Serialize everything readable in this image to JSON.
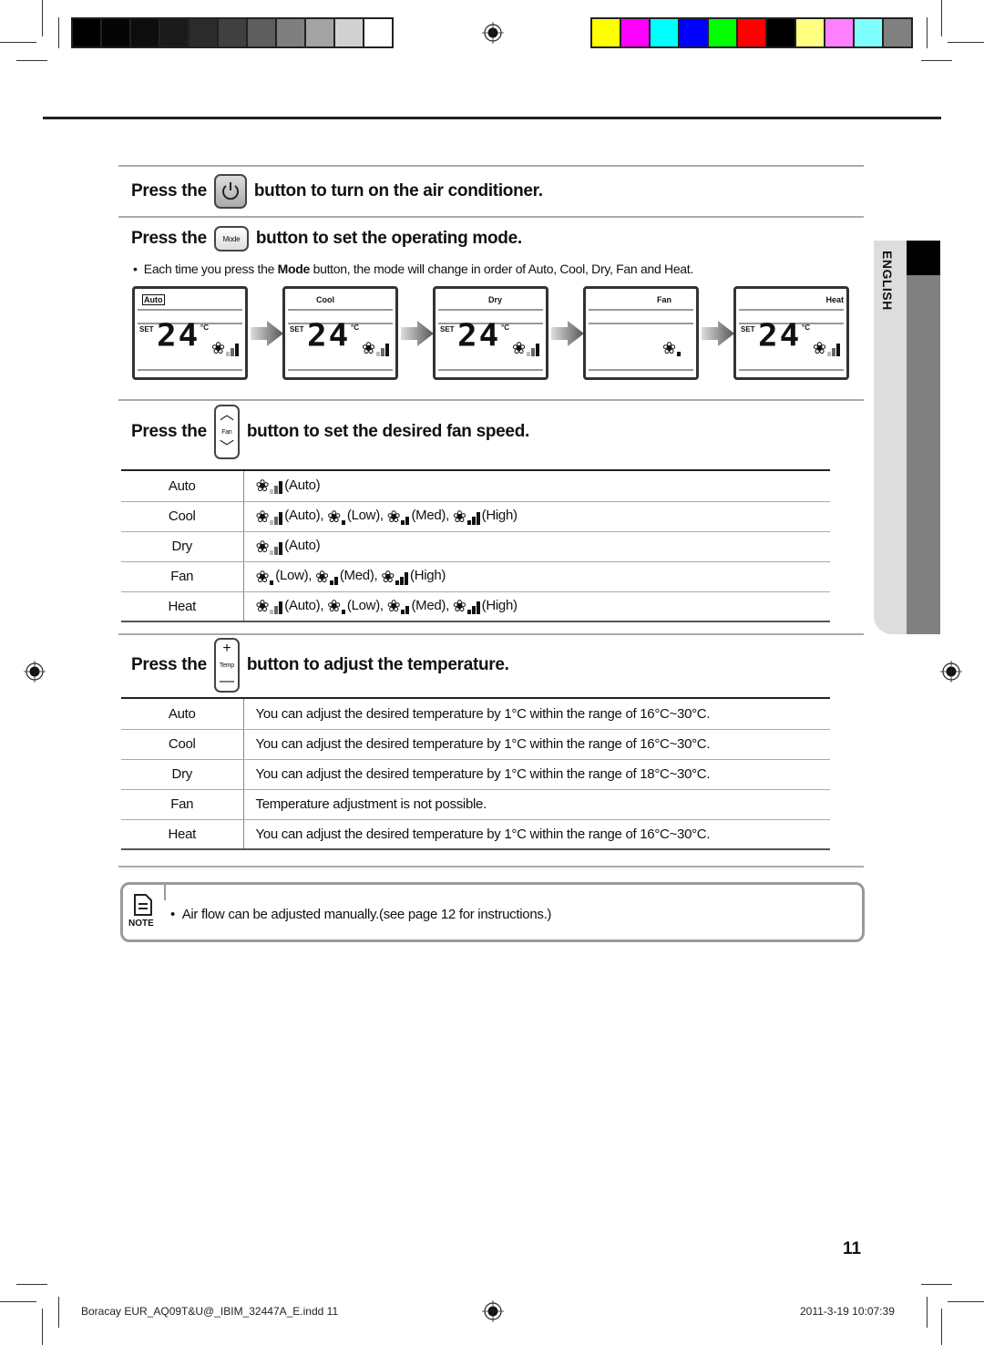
{
  "print_marks": {
    "grayscale_swatches": [
      "#000000",
      "#050505",
      "#0d0d0d",
      "#1a1a1a",
      "#2b2b2b",
      "#404040",
      "#5e5e5e",
      "#7f7f7f",
      "#a3a3a3",
      "#d1d1d1",
      "#ffffff"
    ],
    "color_swatches": [
      "#ffff00",
      "#ff00ff",
      "#00ffff",
      "#0000ff",
      "#00ff00",
      "#ff0000",
      "#000000",
      "#ffff80",
      "#ff80ff",
      "#80ffff",
      "#808080"
    ]
  },
  "side_tab": {
    "label": "ENGLISH"
  },
  "sections": {
    "power": {
      "prefix": "Press the",
      "suffix": "button to turn on the air conditioner.",
      "icon": "power-icon"
    },
    "mode": {
      "prefix": "Press the",
      "button_label": "Mode",
      "suffix": "button to set the operating mode.",
      "bullet_pre": "Each time you press the ",
      "bullet_bold": "Mode",
      "bullet_post": " button, the mode will change in order of Auto, Cool, Dry, Fan and Heat.",
      "displays": [
        {
          "mode": "Auto",
          "set": "SET",
          "temp": "24",
          "unit": "°C",
          "fan_level": "auto"
        },
        {
          "mode": "Cool",
          "set": "SET",
          "temp": "24",
          "unit": "°C",
          "fan_level": "auto"
        },
        {
          "mode": "Dry",
          "set": "SET",
          "temp": "24",
          "unit": "°C",
          "fan_level": "auto"
        },
        {
          "mode": "Fan",
          "set": "",
          "temp": "",
          "unit": "",
          "fan_level": "low"
        },
        {
          "mode": "Heat",
          "set": "SET",
          "temp": "24",
          "unit": "°C",
          "fan_level": "auto"
        }
      ]
    },
    "fan": {
      "prefix": "Press the",
      "button_label": "Fan",
      "suffix": "button to set the desired fan speed.",
      "rows": [
        {
          "mode": "Auto",
          "speeds": [
            "Auto"
          ]
        },
        {
          "mode": "Cool",
          "speeds": [
            "Auto",
            "Low",
            "Med",
            "High"
          ]
        },
        {
          "mode": "Dry",
          "speeds": [
            "Auto"
          ]
        },
        {
          "mode": "Fan",
          "speeds": [
            "Low",
            "Med",
            "High"
          ]
        },
        {
          "mode": "Heat",
          "speeds": [
            "Auto",
            "Low",
            "Med",
            "High"
          ]
        }
      ]
    },
    "temp": {
      "prefix": "Press the",
      "button_label": "Temp",
      "plus": "+",
      "minus": "—",
      "suffix": "button to adjust the temperature.",
      "rows": [
        {
          "mode": "Auto",
          "text": "You can adjust the desired temperature by 1°C within the range of 16°C~30°C."
        },
        {
          "mode": "Cool",
          "text": "You can adjust the desired temperature by 1°C within the range of 16°C~30°C."
        },
        {
          "mode": "Dry",
          "text": "You can adjust the desired temperature by 1°C within the range of 18°C~30°C."
        },
        {
          "mode": "Fan",
          "text": "Temperature adjustment is not possible."
        },
        {
          "mode": "Heat",
          "text": "You can adjust the desired temperature by 1°C within the range of 16°C~30°C."
        }
      ]
    }
  },
  "note": {
    "label": "NOTE",
    "text": "Air flow can be adjusted manually.(see page 12 for instructions.)"
  },
  "page_number": "11",
  "footer": {
    "file": "Boracay EUR_AQ09T&U@_IBIM_32447A_E.indd   11",
    "timestamp": "2011-3-19   10:07:39"
  }
}
